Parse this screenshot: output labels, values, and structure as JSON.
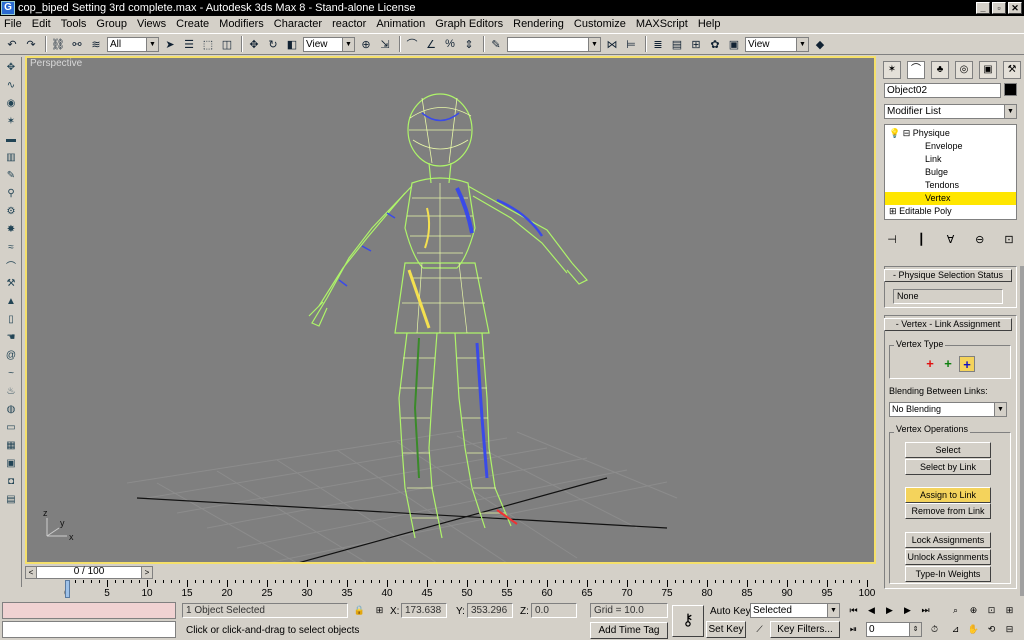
{
  "window": {
    "title": "cop_biped Setting 3rd complete.max - Autodesk 3ds Max 8  - Stand-alone License",
    "controls": [
      "_",
      "▫",
      "✕"
    ]
  },
  "menu": [
    "File",
    "Edit",
    "Tools",
    "Group",
    "Views",
    "Create",
    "Modifiers",
    "Character",
    "reactor",
    "Animation",
    "Graph Editors",
    "Rendering",
    "Customize",
    "MAXScript",
    "Help"
  ],
  "toolbar": {
    "selection_filter": "All",
    "ref_coord_1": "View",
    "named_selection": "",
    "ref_coord_2": "View"
  },
  "viewport": {
    "label": "Perspective",
    "axis_labels": [
      "x",
      "z",
      "y"
    ],
    "border_color": "#f5e06a",
    "background_color": "#7f7f7f"
  },
  "timeslider": {
    "frame": "0 / 100",
    "left_arrow": "<",
    "right_arrow": ">"
  },
  "trackbar": {
    "labels": [
      "0",
      "5",
      "10",
      "15",
      "20",
      "25",
      "30",
      "35",
      "40",
      "45",
      "50",
      "55",
      "60",
      "65",
      "70",
      "75",
      "80",
      "85",
      "90",
      "95",
      "100"
    ]
  },
  "status": {
    "selection_count": "1 Object Selected",
    "prompt": "Click or click-and-drag to select objects",
    "x_label": "X:",
    "x_value": "173.638",
    "y_label": "Y:",
    "y_value": "353.296",
    "z_label": "Z:",
    "z_value": "0.0",
    "grid": "Grid = 10.0",
    "add_time_tag": "Add Time Tag",
    "auto_key": "Auto Key",
    "set_key": "Set Key",
    "key_mode": "Selected",
    "key_filters": "Key Filters...",
    "current_frame": "0"
  },
  "command_panel": {
    "object_name": "Object02",
    "object_color": "#000000",
    "modifier_list": "Modifier List",
    "stack": [
      {
        "label": "Physique",
        "level": 0
      },
      {
        "label": "Envelope",
        "level": 1
      },
      {
        "label": "Link",
        "level": 1
      },
      {
        "label": "Bulge",
        "level": 1
      },
      {
        "label": "Tendons",
        "level": 1
      },
      {
        "label": "Vertex",
        "level": 1,
        "selected": true
      },
      {
        "label": "Editable Poly",
        "level": 0
      }
    ],
    "rollout_selection_status": {
      "title": "Physique Selection Status",
      "collapse": "-",
      "value": "None"
    },
    "rollout_vertex_link": {
      "title": "Vertex - Link Assignment",
      "collapse": "-",
      "vertex_type_label": "Vertex Type",
      "vertex_type_symbols": [
        "+",
        "+",
        "+"
      ],
      "vertex_type_colors": [
        "#e01010",
        "#108010",
        "#1010c0"
      ],
      "blending_label": "Blending Between Links:",
      "blending_value": "No Blending",
      "vertex_operations_label": "Vertex Operations",
      "buttons": {
        "select": "Select",
        "select_by_link": "Select by Link",
        "assign_to_link": "Assign to Link",
        "remove_from_link": "Remove from Link",
        "lock_assignments": "Lock Assignments",
        "unlock_assignments": "Unlock Assignments",
        "type_in_weights": "Type-In Weights"
      }
    }
  }
}
